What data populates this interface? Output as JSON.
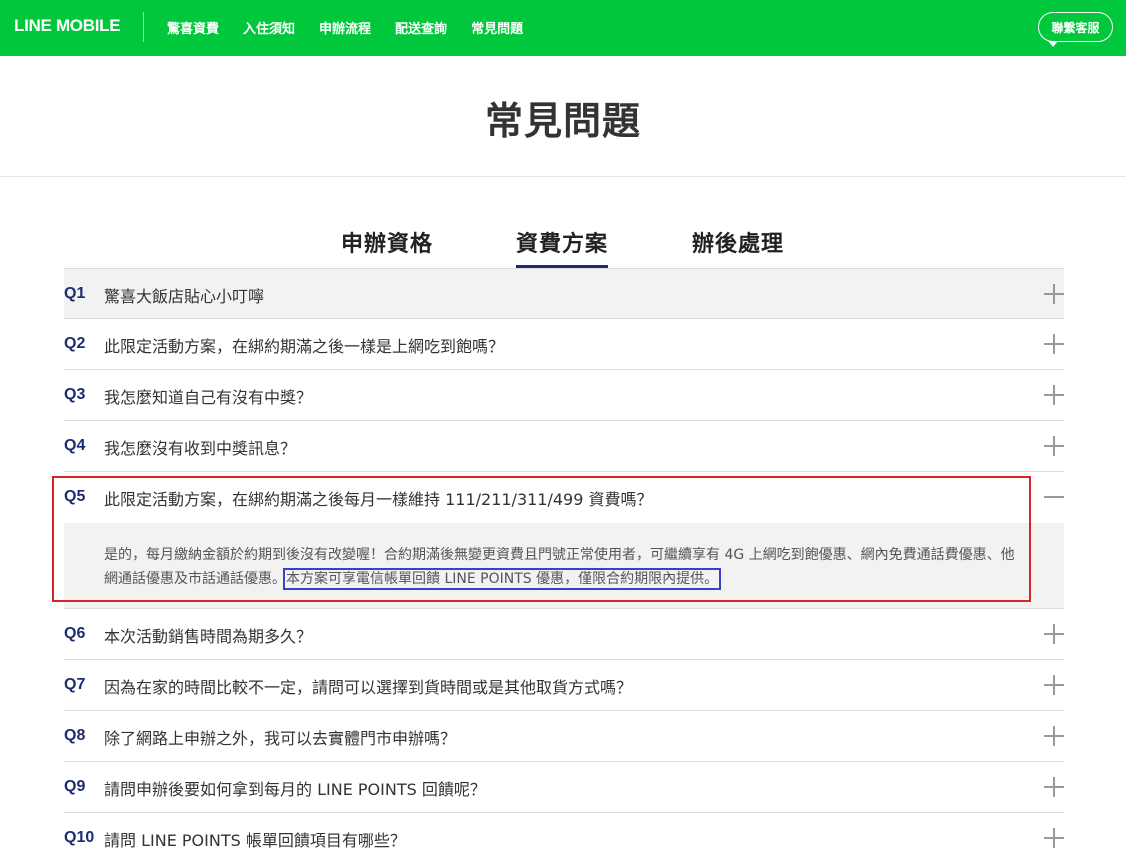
{
  "header": {
    "logo": "LINE MOBILE",
    "nav": [
      "驚喜資費",
      "入住須知",
      "申辦流程",
      "配送查詢",
      "常見問題"
    ],
    "contact": "聯繫客服"
  },
  "page_title": "常見問題",
  "tabs": [
    {
      "label": "申辦資格"
    },
    {
      "label": "資費方案"
    },
    {
      "label": "辦後處理"
    }
  ],
  "faq": [
    {
      "num": "Q1",
      "question": "驚喜大飯店貼心小叮嚀",
      "state": "collapsed",
      "icon": "plus-icon"
    },
    {
      "num": "Q2",
      "question": "此限定活動方案，在綁約期滿之後一樣是上網吃到飽嗎？",
      "state": "collapsed",
      "icon": "plus-icon"
    },
    {
      "num": "Q3",
      "question": "我怎麼知道自己有沒有中獎？",
      "state": "collapsed",
      "icon": "plus-icon"
    },
    {
      "num": "Q4",
      "question": "我怎麼沒有收到中獎訊息？",
      "state": "collapsed",
      "icon": "plus-icon"
    },
    {
      "num": "Q5",
      "question": "此限定活動方案，在綁約期滿之後每月一樣維持 111/211/311/499 資費嗎？",
      "state": "expanded",
      "icon": "minus-icon",
      "answer": "是的，每月繳納金額於約期到後沒有改變喔！合約期滿後無變更資費且門號正常使用者，可繼續享有 4G 上網吃到飽優惠、網內免費通話費優惠、他網通話優惠及市話通話優惠。",
      "answer_highlight": "本方案可享電信帳單回饋 LINE POINTS 優惠，僅限合約期限內提供。"
    },
    {
      "num": "Q6",
      "question": "本次活動銷售時間為期多久？",
      "state": "collapsed",
      "icon": "plus-icon"
    },
    {
      "num": "Q7",
      "question": "因為在家的時間比較不一定，請問可以選擇到貨時間或是其他取貨方式嗎？",
      "state": "collapsed",
      "icon": "plus-icon"
    },
    {
      "num": "Q8",
      "question": "除了網路上申辦之外，我可以去實體門市申辦嗎？",
      "state": "collapsed",
      "icon": "plus-icon"
    },
    {
      "num": "Q9",
      "question": "請問申辦後要如何拿到每月的 LINE POINTS 回饋呢？",
      "state": "collapsed",
      "icon": "plus-icon"
    },
    {
      "num": "Q10",
      "question": "請問 LINE POINTS 帳單回饋項目有哪些？",
      "state": "collapsed",
      "icon": "plus-icon"
    }
  ],
  "colors": {
    "brand_green": "#00c73c",
    "question_number": "#1e2b6e",
    "active_tab_underline": "#1e2b6e",
    "annotation_red": "#d8232a",
    "annotation_blue": "#3b3fc9"
  }
}
